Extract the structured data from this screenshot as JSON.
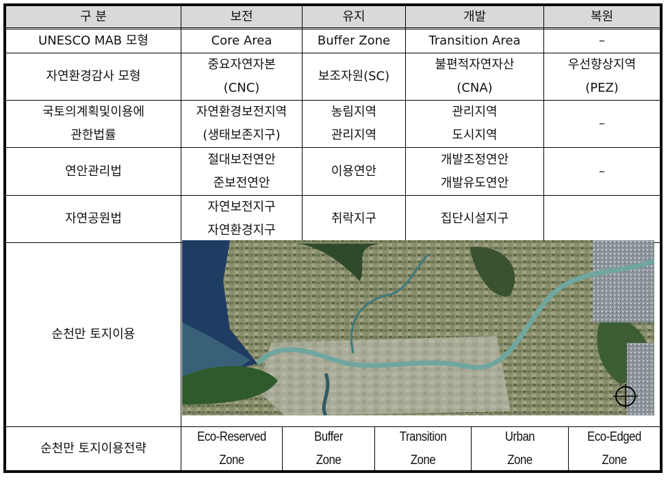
{
  "table": {
    "header": {
      "category": "구 분",
      "columns": [
        "보전",
        "유지",
        "개발",
        "복원"
      ]
    },
    "rows": [
      {
        "label": [
          "UNESCO MAB 모형"
        ],
        "cells": [
          [
            "Core Area"
          ],
          [
            "Buffer Zone"
          ],
          [
            "Transition Area"
          ],
          [
            "–"
          ]
        ]
      },
      {
        "label": [
          "자연환경감사 모형"
        ],
        "cells": [
          [
            "중요자연자본",
            "(CNC)"
          ],
          [
            "보조자원(SC)"
          ],
          [
            "불편적자연자산",
            "(CNA)"
          ],
          [
            "우선향상지역",
            "(PEZ)"
          ]
        ]
      },
      {
        "label": [
          "국토의계획및이용에",
          "관한법률"
        ],
        "cells": [
          [
            "자연환경보전지역",
            "(생태보존지구)"
          ],
          [
            "농림지역",
            "관리지역"
          ],
          [
            "관리지역",
            "도시지역"
          ],
          [
            "–"
          ]
        ]
      },
      {
        "label": [
          "연안관리법"
        ],
        "cells": [
          [
            "절대보전연안",
            "준보전연안"
          ],
          [
            "이용연안"
          ],
          [
            "개발조정연안",
            "개발유도연안"
          ],
          [
            "–"
          ]
        ]
      },
      {
        "label": [
          "자연공원법"
        ],
        "cells": [
          [
            "자연보전지구",
            "자연환경지구"
          ],
          [
            "취락지구"
          ],
          [
            "집단시설지구"
          ],
          [
            ""
          ]
        ]
      }
    ],
    "image_row": {
      "label": "순천만 토지이용",
      "image_alt": "순천만 위성사진"
    },
    "strategy_row": {
      "label": "순천만 토지이용전략",
      "zones": [
        [
          "Eco-Reserved",
          "Zone"
        ],
        [
          "Buffer",
          "Zone"
        ],
        [
          "Transition",
          "Zone"
        ],
        [
          "Urban",
          "Zone"
        ],
        [
          "Eco-Edged",
          "Zone"
        ]
      ]
    }
  }
}
